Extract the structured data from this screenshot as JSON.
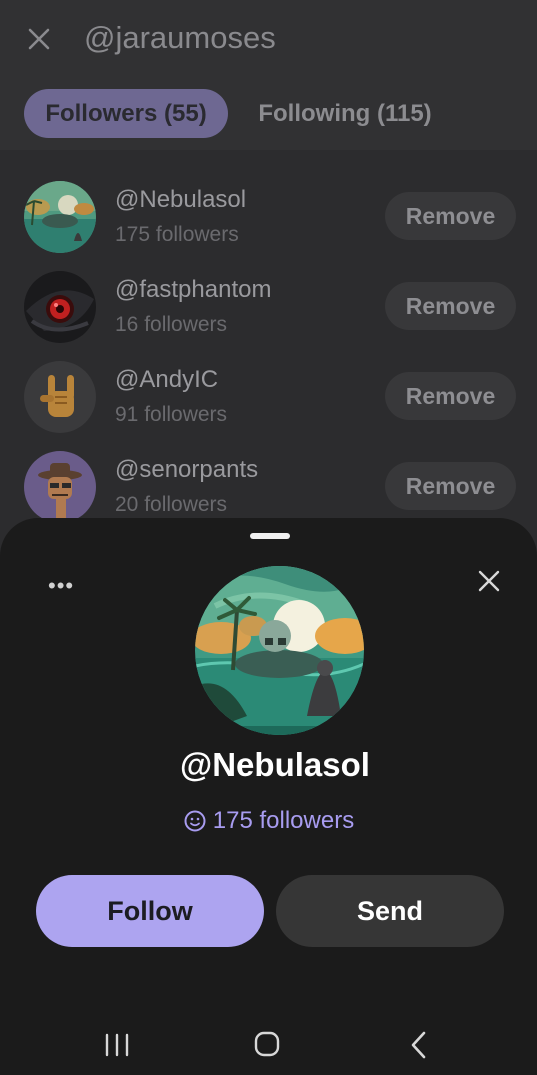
{
  "header": {
    "title": "@jaraumoses"
  },
  "tabs": [
    {
      "label": "Followers (55)",
      "active": true
    },
    {
      "label": "Following (115)",
      "active": false
    }
  ],
  "list": {
    "items": [
      {
        "username": "@Nebulasol",
        "followers": "175 followers",
        "action": "Remove",
        "avatar": "nebula-art"
      },
      {
        "username": "@fastphantom",
        "followers": "16 followers",
        "action": "Remove",
        "avatar": "red-eye"
      },
      {
        "username": "@AndyIC",
        "followers": "91 followers",
        "action": "Remove",
        "avatar": "rock-hand-emoji"
      },
      {
        "username": "@senorpants",
        "followers": "20 followers",
        "action": "Remove",
        "avatar": "cowboy-avatar"
      }
    ]
  },
  "sheet": {
    "more_label": "•••",
    "profile_name": "@Nebulasol",
    "followers": "175 followers",
    "follow_label": "Follow",
    "send_label": "Send"
  },
  "colors": {
    "accent": "#ada4f0",
    "accent_text": "#a89cf0",
    "sheet_bg": "#1b1b1b",
    "dim_bg": "#2c2c2e"
  }
}
